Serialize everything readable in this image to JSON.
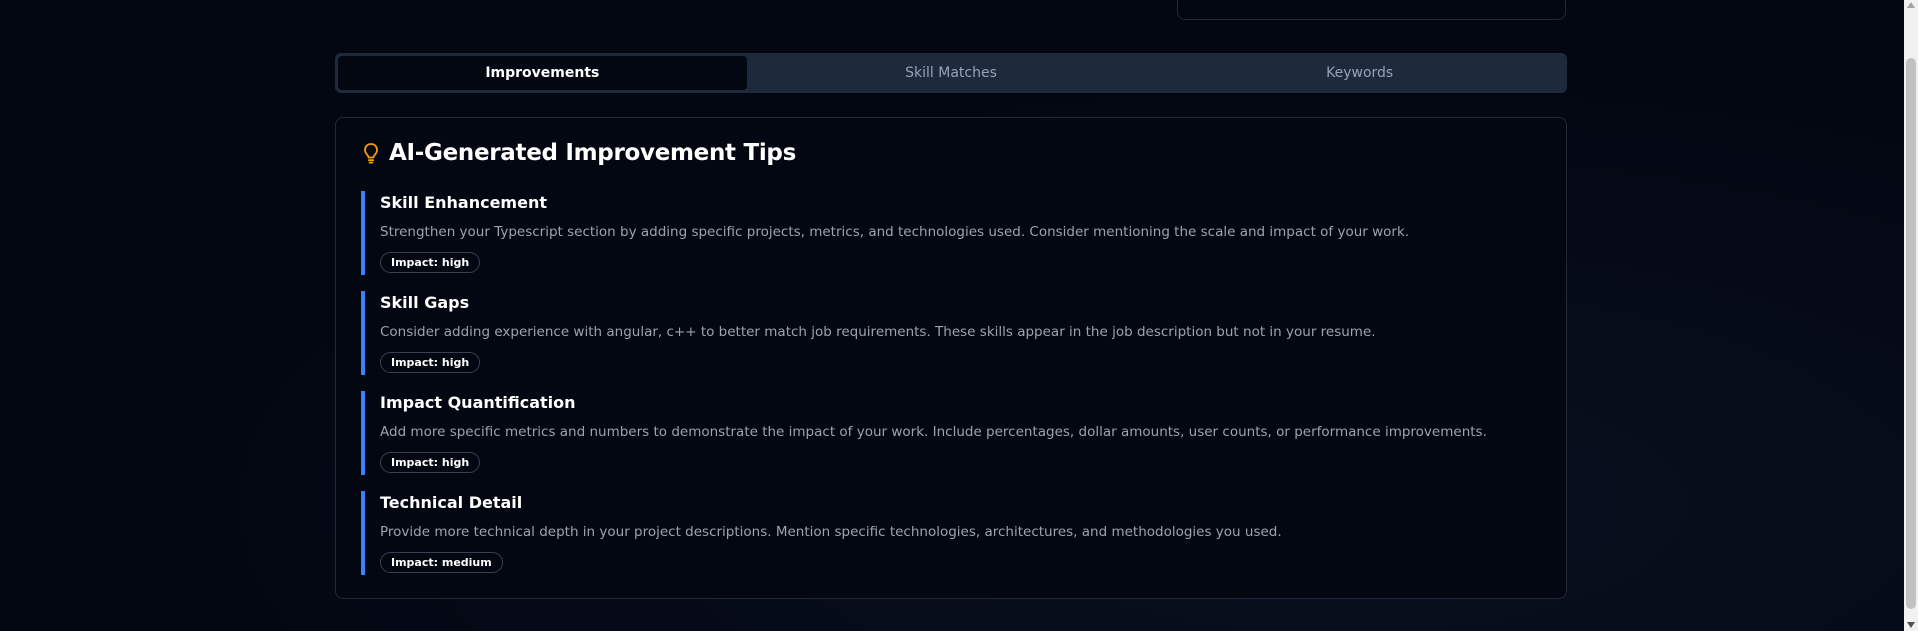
{
  "tabs": [
    {
      "label": "Improvements",
      "active": true
    },
    {
      "label": "Skill Matches",
      "active": false
    },
    {
      "label": "Keywords",
      "active": false
    }
  ],
  "card": {
    "icon": "lightbulb-icon",
    "title": "AI-Generated Improvement Tips"
  },
  "tips": [
    {
      "title": "Skill Enhancement",
      "description": "Strengthen your Typescript section by adding specific projects, metrics, and technologies used. Consider mentioning the scale and impact of your work.",
      "impact": "Impact: high"
    },
    {
      "title": "Skill Gaps",
      "description": "Consider adding experience with angular, c++ to better match job requirements. These skills appear in the job description but not in your resume.",
      "impact": "Impact: high"
    },
    {
      "title": "Impact Quantification",
      "description": "Add more specific metrics and numbers to demonstrate the impact of your work. Include percentages, dollar amounts, user counts, or performance improvements.",
      "impact": "Impact: high"
    },
    {
      "title": "Technical Detail",
      "description": "Provide more technical depth in your project descriptions. Mention specific technologies, architectures, and methodologies you used.",
      "impact": "Impact: medium"
    }
  ],
  "colors": {
    "background": "#030712",
    "accent_border": "#3b82f6",
    "icon": "#f59e0b",
    "tab_bar": "#1e293b"
  }
}
